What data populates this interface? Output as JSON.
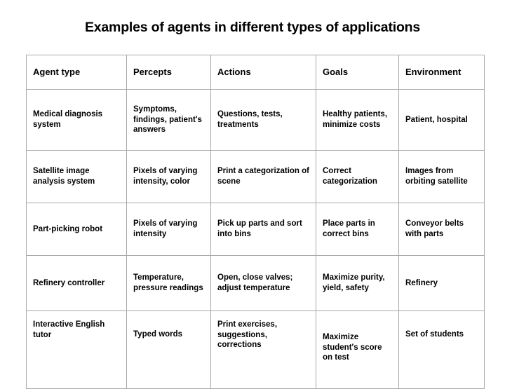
{
  "slide": {
    "title": "Examples of agents in different types of applications",
    "background_color": "#ffffff",
    "text_color": "#000000",
    "border_color": "#a8a8a8"
  },
  "table": {
    "headers": [
      "Agent type",
      "Percepts",
      "Actions",
      "Goals",
      "Environment"
    ],
    "rows": [
      {
        "agent_type": "Medical diagnosis system",
        "percepts": "Symptoms, findings, patient's answers",
        "actions": "Questions, tests, treatments",
        "goals": "Healthy patients, minimize costs",
        "environment": "Patient, hospital"
      },
      {
        "agent_type": "Satellite image analysis system",
        "percepts": "Pixels of varying intensity, color",
        "actions": "Print a categorization of scene",
        "goals": "Correct categorization",
        "environment": "Images from orbiting satellite"
      },
      {
        "agent_type": "Part-picking robot",
        "percepts": "Pixels of varying intensity",
        "actions": "Pick up parts and sort into bins",
        "goals": "Place parts in correct bins",
        "environment": "Conveyor belts with parts"
      },
      {
        "agent_type": "Refinery controller",
        "percepts": "Temperature, pressure readings",
        "actions": "Open, close valves; adjust temperature",
        "goals": "Maximize purity, yield, safety",
        "environment": "Refinery"
      },
      {
        "agent_type": "Interactive English tutor",
        "percepts": "Typed words",
        "actions": "Print exercises, suggestions, corrections",
        "goals": "Maximize student's score on test",
        "environment": "Set of students"
      }
    ]
  }
}
